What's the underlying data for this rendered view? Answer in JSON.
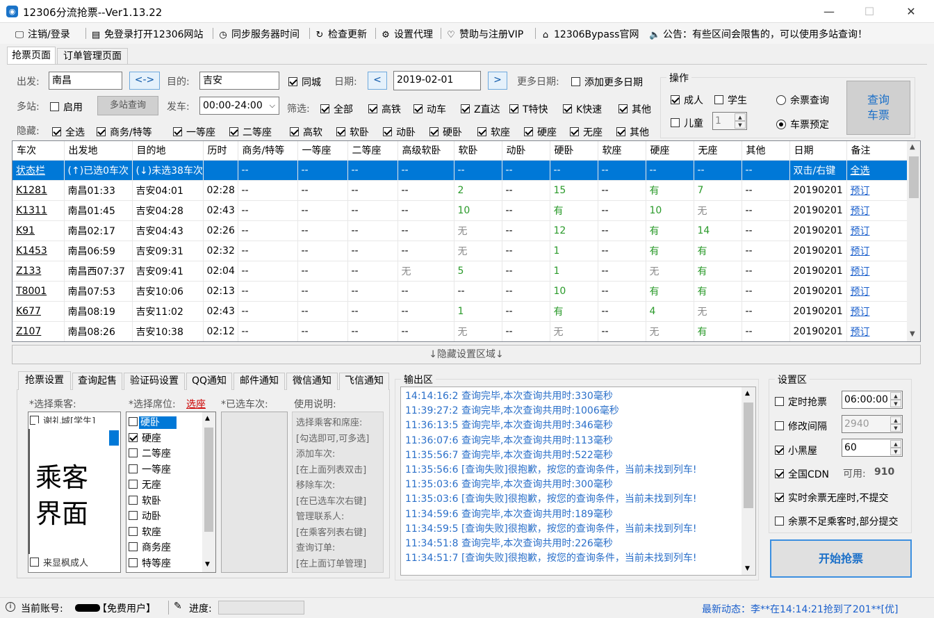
{
  "window": {
    "title": "12306分流抢票--Ver1.13.22",
    "min": "—",
    "max": "☐",
    "close": "✕"
  },
  "menu": [
    {
      "icon": "🖵",
      "name": "logout-login",
      "label": "注销/登录"
    },
    {
      "icon": "▤",
      "name": "open-12306",
      "label": "免登录打开12306网站"
    },
    {
      "icon": "◷",
      "name": "sync-time",
      "label": "同步服务器时间"
    },
    {
      "icon": "↻",
      "name": "check-update",
      "label": "检查更新"
    },
    {
      "icon": "⚙",
      "name": "proxy",
      "label": "设置代理"
    },
    {
      "icon": "♡",
      "name": "donate",
      "label": "赞助与注册VIP"
    },
    {
      "icon": "⌂",
      "name": "bypass-site",
      "label": "12306Bypass官网"
    },
    {
      "icon": "🔈",
      "name": "notice",
      "label": "公告：有些区间会限售的，可以使用多站查询！"
    }
  ],
  "main_tabs": {
    "grab": "抢票页面",
    "orders": "订单管理页面"
  },
  "search": {
    "from_label": "出发:",
    "from_value": "南昌",
    "swap": "<->",
    "to_label": "目的:",
    "to_value": "吉安",
    "same_city": "同城",
    "date_label": "日期:",
    "prev": "<",
    "date": "2019-02-01",
    "next": ">",
    "more_dates_label": "更多日期:",
    "more_dates_check": "添加更多日期",
    "multi_label": "多站:",
    "multi_enable": "启用",
    "multi_query": "多站查询",
    "depart_label": "发车:",
    "depart_value": "00:00-24:00",
    "filter_label": "筛选:",
    "filters": [
      "全部",
      "高铁",
      "动车",
      "Z直达",
      "T特快",
      "K快速",
      "其他"
    ],
    "hide_label": "隐藏:",
    "hides": [
      "全选",
      "商务/特等",
      "一等座",
      "二等座",
      "高软",
      "软卧",
      "动卧",
      "硬卧",
      "软座",
      "硬座",
      "无座",
      "其他"
    ]
  },
  "ops": {
    "title": "操作",
    "adult": "成人",
    "student": "学生",
    "child": "儿童",
    "child_count": "1",
    "remain_query": "余票查询",
    "book": "车票预定",
    "query_btn_l1": "查询",
    "query_btn_l2": "车票"
  },
  "grid": {
    "headers": [
      "车次",
      "出发地",
      "目的地",
      "历时",
      "商务/特等",
      "一等座",
      "二等座",
      "高级软卧",
      "软卧",
      "动卧",
      "硬卧",
      "软座",
      "硬座",
      "无座",
      "其他",
      "日期",
      "备注"
    ],
    "rows": [
      {
        "sel": true,
        "c": [
          "状态栏",
          "(↑)已选0车次",
          "(↓)未选38车次",
          "",
          "--",
          "--",
          "--",
          "--",
          "--",
          "--",
          "--",
          "--",
          "--",
          "--",
          "--",
          "双击/右键",
          "全选"
        ]
      },
      {
        "c": [
          "K1281",
          "南昌01:33",
          "吉安04:01",
          "02:28",
          "--",
          "--",
          "--",
          "--",
          "2",
          "--",
          "15",
          "--",
          "有",
          "7",
          "--",
          "20190201",
          "预订"
        ]
      },
      {
        "c": [
          "K1311",
          "南昌01:45",
          "吉安04:28",
          "02:43",
          "--",
          "--",
          "--",
          "--",
          "10",
          "--",
          "有",
          "--",
          "10",
          "无",
          "--",
          "20190201",
          "预订"
        ]
      },
      {
        "c": [
          "K91",
          "南昌02:17",
          "吉安04:43",
          "02:26",
          "--",
          "--",
          "--",
          "--",
          "无",
          "--",
          "12",
          "--",
          "有",
          "14",
          "--",
          "20190201",
          "预订"
        ]
      },
      {
        "c": [
          "K1453",
          "南昌06:59",
          "吉安09:31",
          "02:32",
          "--",
          "--",
          "--",
          "--",
          "无",
          "--",
          "1",
          "--",
          "有",
          "有",
          "--",
          "20190201",
          "预订"
        ]
      },
      {
        "c": [
          "Z133",
          "南昌西07:37",
          "吉安09:41",
          "02:04",
          "--",
          "--",
          "--",
          "无",
          "5",
          "--",
          "1",
          "--",
          "无",
          "有",
          "--",
          "20190201",
          "预订"
        ]
      },
      {
        "c": [
          "T8001",
          "南昌07:53",
          "吉安10:06",
          "02:13",
          "--",
          "--",
          "--",
          "--",
          "--",
          "--",
          "10",
          "--",
          "有",
          "有",
          "--",
          "20190201",
          "预订"
        ]
      },
      {
        "c": [
          "K677",
          "南昌08:19",
          "吉安11:02",
          "02:43",
          "--",
          "--",
          "--",
          "--",
          "1",
          "--",
          "有",
          "--",
          "4",
          "无",
          "--",
          "20190201",
          "预订"
        ]
      },
      {
        "c": [
          "Z107",
          "南昌08:26",
          "吉安10:38",
          "02:12",
          "--",
          "--",
          "--",
          "--",
          "无",
          "--",
          "无",
          "--",
          "无",
          "有",
          "--",
          "20190201",
          "预订"
        ]
      }
    ]
  },
  "hidden_bar": "↓隐藏设置区域↓",
  "sub_tabs": [
    "抢票设置",
    "查询起售",
    "验证码设置",
    "QQ通知",
    "邮件通知",
    "微信通知",
    "飞信通知"
  ],
  "passenger": {
    "title": "*选择乘客:",
    "placeholder": "乘客\n界面",
    "peek_first": "谢礼城[学生]",
    "peek_last": "来显枫成人"
  },
  "seats": {
    "title": "*选择席位:",
    "select": "选座",
    "items": [
      {
        "l": "硬卧",
        "on": false,
        "sel": true
      },
      {
        "l": "硬座",
        "on": true
      },
      {
        "l": "二等座",
        "on": false
      },
      {
        "l": "一等座",
        "on": false
      },
      {
        "l": "无座",
        "on": false
      },
      {
        "l": "软卧",
        "on": false
      },
      {
        "l": "动卧",
        "on": false
      },
      {
        "l": "软座",
        "on": false
      },
      {
        "l": "商务座",
        "on": false
      },
      {
        "l": "特等座",
        "on": false
      }
    ]
  },
  "selected_trains": {
    "title": "*已选车次:"
  },
  "usage": {
    "title": "使用说明:",
    "lines": [
      "选择乘客和席座:",
      "[勾选即可,可多选]",
      "添加车次:",
      "[在上面列表双击]",
      "移除车次:",
      "[在已选车次右键]",
      "管理联系人:",
      "[在乘客列表右键]",
      "查询订单:",
      "[在上面订单管理]"
    ]
  },
  "output": {
    "title": "输出区",
    "logs": [
      "14:14:16:2  查询完毕,本次查询共用时:330毫秒",
      "11:39:27:2  查询完毕,本次查询共用时:1006毫秒",
      "11:36:13:5  查询完毕,本次查询共用时:346毫秒",
      "11:36:07:6  查询完毕,本次查询共用时:113毫秒",
      "11:35:56:7  查询完毕,本次查询共用时:522毫秒",
      "11:35:56:6  [查询失败]很抱歉，按您的查询条件，当前未找到列车!",
      "11:35:03:6  查询完毕,本次查询共用时:300毫秒",
      "11:35:03:6  [查询失败]很抱歉，按您的查询条件，当前未找到列车!",
      "11:34:59:6  查询完毕,本次查询共用时:189毫秒",
      "11:34:59:5  [查询失败]很抱歉，按您的查询条件，当前未找到列车!",
      "11:34:51:8  查询完毕,本次查询共用时:226毫秒",
      "11:34:51:7  [查询失败]很抱歉，按您的查询条件，当前未找到列车!"
    ]
  },
  "settings": {
    "title": "设置区",
    "timed": "定时抢票",
    "timed_value": "06:00:00",
    "interval": "修改间隔",
    "interval_value": "2940",
    "blackroom": "小黑屋",
    "blackroom_value": "60",
    "cdn": "全国CDN",
    "cdn_avail_label": "可用:",
    "cdn_avail": "910",
    "no_submit": "实时余票无座时,不提交",
    "partial": "余票不足乘客时,部分提交",
    "start": "开始抢票"
  },
  "status": {
    "account_label": "当前账号:",
    "account_tag": "【免费用户】",
    "progress_label": "进度:",
    "news": "最新动态：李**在14:14:21抢到了201**[优]"
  }
}
